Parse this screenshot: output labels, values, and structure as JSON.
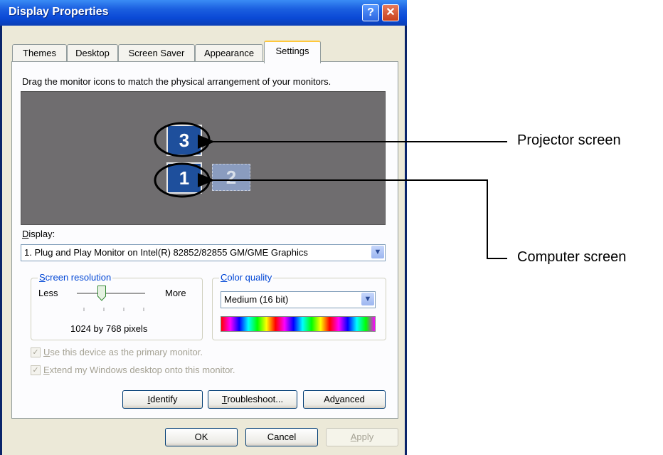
{
  "window": {
    "title": "Display Properties",
    "help_glyph": "?",
    "close_glyph": "✕"
  },
  "tabs": [
    {
      "label": "Themes",
      "active": false
    },
    {
      "label": "Desktop",
      "active": false
    },
    {
      "label": "Screen Saver",
      "active": false
    },
    {
      "label": "Appearance",
      "active": false
    },
    {
      "label": "Settings",
      "active": true
    }
  ],
  "instructions": "Drag the monitor icons to match the physical arrangement of your monitors.",
  "monitors": [
    {
      "number": "3",
      "state": "enabled"
    },
    {
      "number": "1",
      "state": "selected"
    },
    {
      "number": "2",
      "state": "inactive"
    }
  ],
  "display": {
    "label_first": "D",
    "label_rest": "isplay:",
    "value": "1. Plug and Play Monitor on Intel(R) 82852/82855 GM/GME Graphics"
  },
  "resolution": {
    "legend_first": "S",
    "legend_rest": "creen resolution",
    "less": "Less",
    "more": "More",
    "value_text": "1024 by 768 pixels",
    "slider_fraction": 0.36
  },
  "color_quality": {
    "legend_first": "C",
    "legend_rest": "olor quality",
    "value": "Medium (16 bit)"
  },
  "checkboxes": [
    {
      "first": "U",
      "rest": "se this device as the primary monitor.",
      "checked": true,
      "enabled": false
    },
    {
      "first": "E",
      "rest": "xtend my Windows desktop onto this monitor.",
      "checked": true,
      "enabled": false
    }
  ],
  "buttons": {
    "identify_first": "I",
    "identify_rest": "dentify",
    "troubleshoot_first": "T",
    "troubleshoot_rest": "roubleshoot...",
    "advanced_pre": "Ad",
    "advanced_u": "v",
    "advanced_post": "anced",
    "ok": "OK",
    "cancel": "Cancel",
    "apply_first": "A",
    "apply_rest": "pply"
  },
  "annotations": {
    "projector": "Projector screen",
    "computer": "Computer screen"
  },
  "colors": {
    "titlebar": "#0a49d6",
    "monitor_area": "#6f6d6f",
    "monitor_active": "#1e4f9c",
    "group_legend": "#0046d5"
  }
}
